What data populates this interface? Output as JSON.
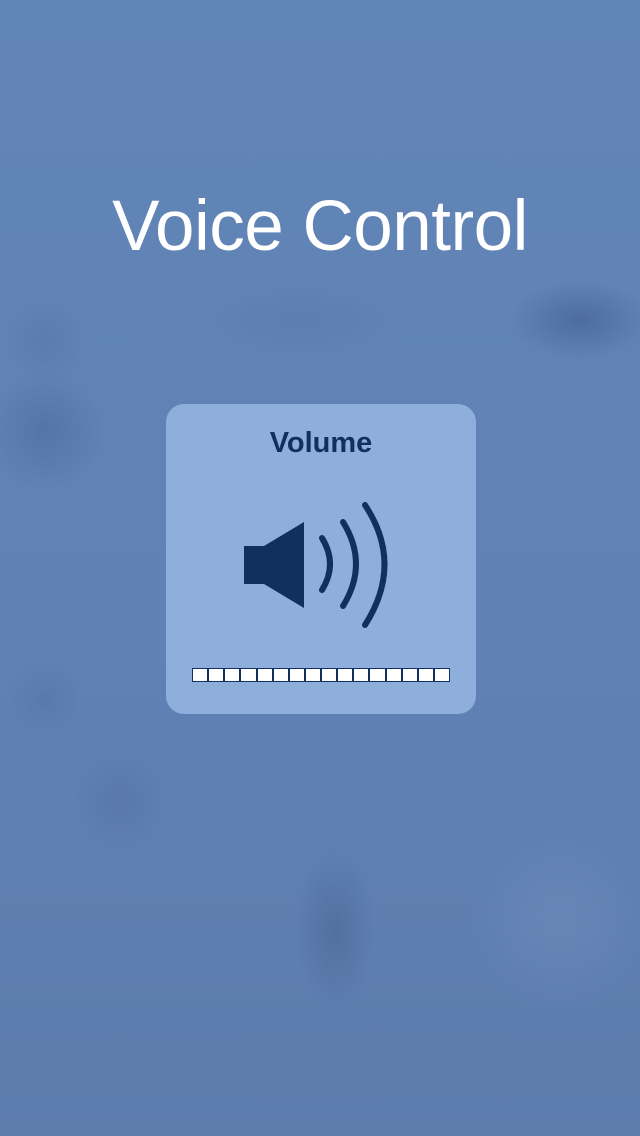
{
  "screen": {
    "title": "Voice Control"
  },
  "volume_hud": {
    "label": "Volume",
    "icon": "speaker-volume-icon",
    "level_segments_total": 16,
    "level_segments_filled": 0,
    "colors": {
      "panel": "#8eaedb",
      "foreground": "#12305e",
      "segment_empty": "#ffffff"
    }
  }
}
